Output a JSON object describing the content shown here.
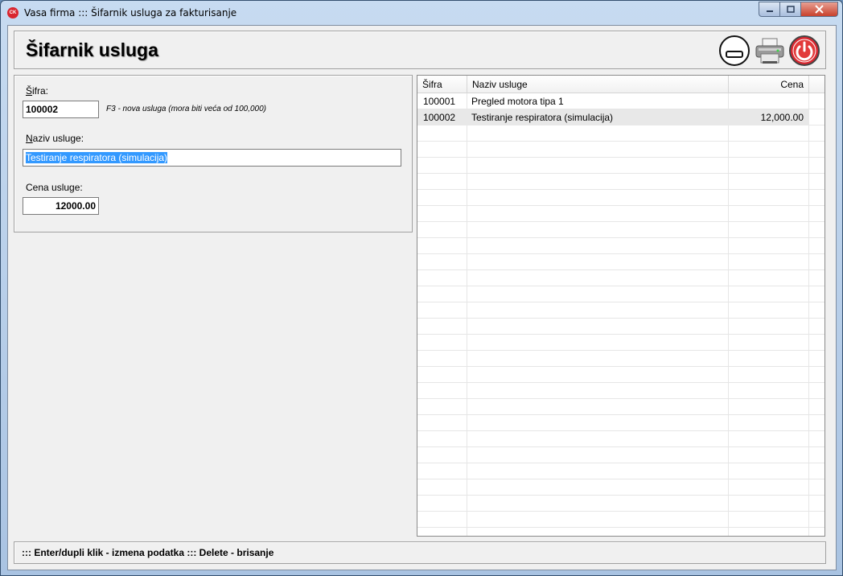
{
  "window": {
    "title": "Vasa firma ::: Šifarnik usluga za fakturisanje",
    "app_icon_text": "CK"
  },
  "header": {
    "title": "Šifarnik usluga"
  },
  "form": {
    "code_label_prefix": "Š",
    "code_label_rest": "ifra:",
    "code_value": "100002",
    "code_hint": "F3 - nova usluga (mora biti veća od 100,000)",
    "name_label_prefix": "N",
    "name_label_rest": "aziv usluge:",
    "name_value": "Testiranje respiratora (simulacija)",
    "price_label": "Cena usluge:",
    "price_value": "12000.00"
  },
  "grid": {
    "columns": [
      "Šifra",
      "Naziv usluge",
      "Cena"
    ],
    "rows": [
      {
        "code": "100001",
        "name": "Pregled motora tipa 1",
        "price": ""
      },
      {
        "code": "100002",
        "name": "Testiranje respiratora (simulacija)",
        "price": "12,000.00"
      }
    ],
    "selected_row": 1
  },
  "status": {
    "text": "::: Enter/dupli klik - izmena podatka ::: Delete - brisanje"
  },
  "colors": {
    "selection": "#3399ff",
    "power_button": "#d9262f"
  }
}
